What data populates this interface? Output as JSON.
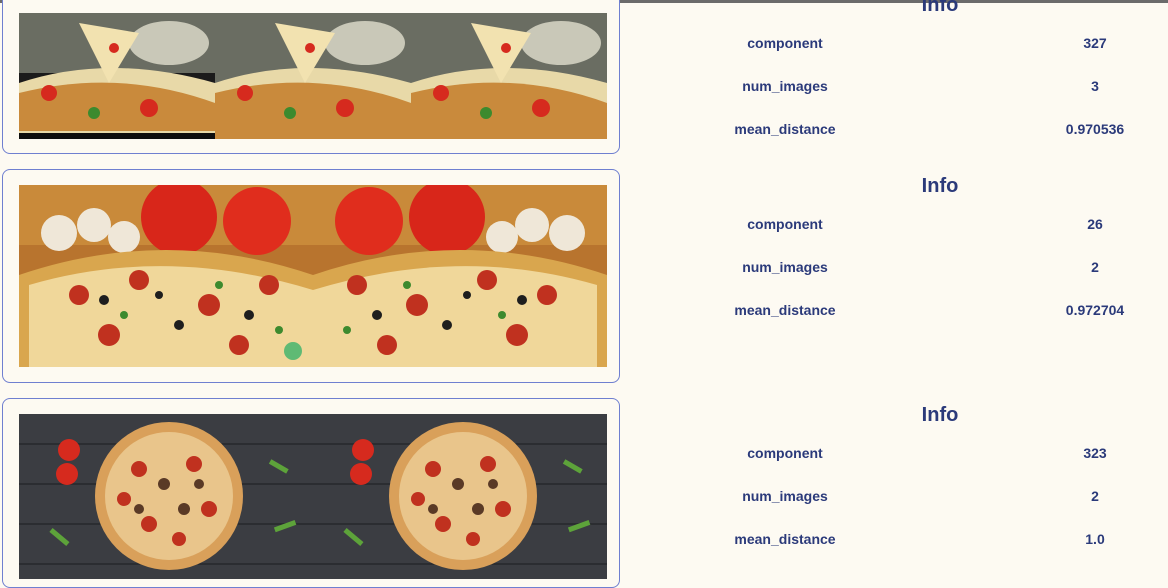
{
  "groups": [
    {
      "info_title": "Info",
      "rows": [
        {
          "key": "component",
          "value": "327"
        },
        {
          "key": "num_images",
          "value": "3"
        },
        {
          "key": "mean_distance",
          "value": "0.970536"
        }
      ]
    },
    {
      "info_title": "Info",
      "rows": [
        {
          "key": "component",
          "value": "26"
        },
        {
          "key": "num_images",
          "value": "2"
        },
        {
          "key": "mean_distance",
          "value": "0.972704"
        }
      ]
    },
    {
      "info_title": "Info",
      "rows": [
        {
          "key": "component",
          "value": "323"
        },
        {
          "key": "num_images",
          "value": "2"
        },
        {
          "key": "mean_distance",
          "value": "1.0"
        }
      ]
    }
  ],
  "colors": {
    "accent_text": "#2b3a7a",
    "card_border": "#6f7fd0",
    "background": "#fdfaf2"
  }
}
